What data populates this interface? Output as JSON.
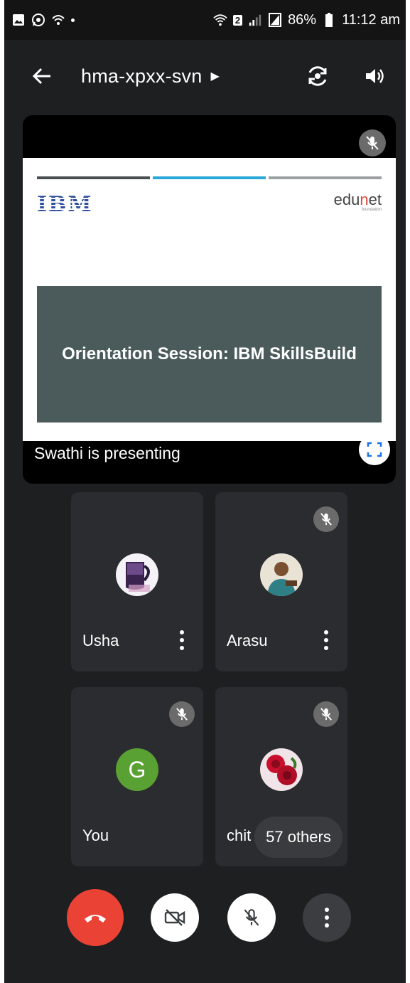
{
  "status_bar": {
    "sim_badge": "2",
    "battery": "86%",
    "time": "11:12 am"
  },
  "top_bar": {
    "meeting_code": "hma-xpxx-svn"
  },
  "presentation": {
    "slide_logo": "IBM",
    "slide_brand_prefix": "edu",
    "slide_brand_accent": "n",
    "slide_brand_suffix": "et",
    "slide_brand_tagline": "foundation",
    "slide_title": "Orientation Session: IBM SkillsBuild",
    "presenting_label": "Swathi is presenting",
    "bar_colors": [
      "#4a4f52",
      "#2ba8d8",
      "#9aa0a3"
    ]
  },
  "participants": [
    {
      "name": "Usha",
      "muted": false
    },
    {
      "name": "Arasu",
      "muted": true
    },
    {
      "name": "You",
      "initial": "G",
      "muted": true
    },
    {
      "name": "chit",
      "muted": true
    }
  ],
  "others_chip": "57 others",
  "colors": {
    "hangup": "#ea4335",
    "avatar_green": "#5aa133",
    "tile_bg": "#2b2c2f"
  }
}
